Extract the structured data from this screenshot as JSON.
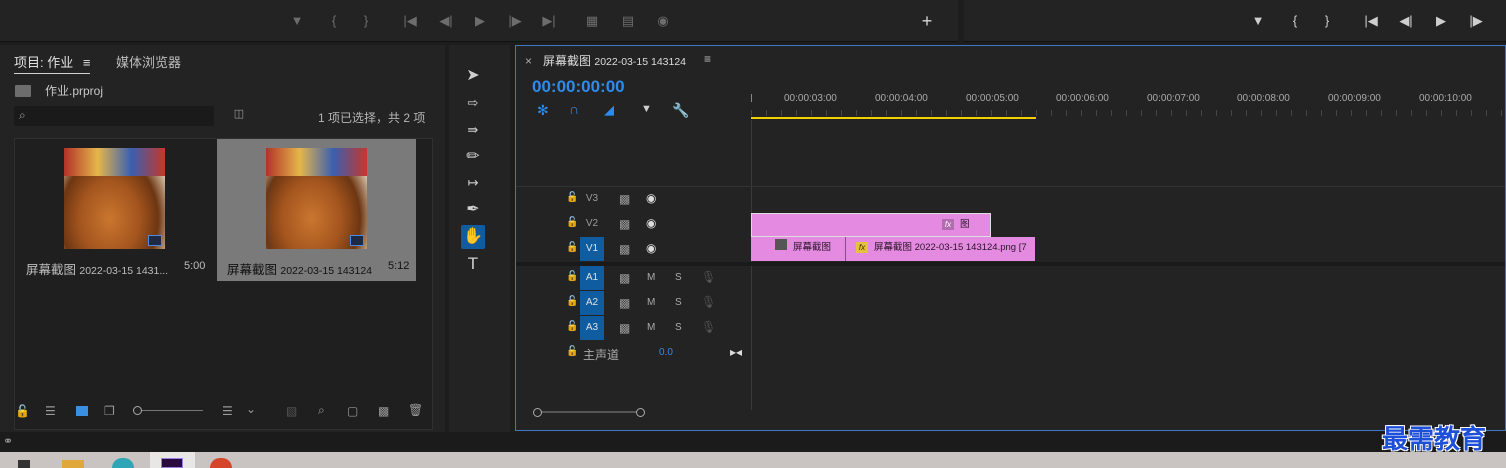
{
  "project": {
    "tabs": [
      "项目: 作业",
      "媒体浏览器"
    ],
    "menu_glyph": "≡",
    "file_name": "作业.prproj",
    "search_value": "",
    "selection_status": "1 项已选择，共 2 项",
    "items": [
      {
        "name": "屏幕截图",
        "date": "2022-03-15 1431...",
        "duration": "5:00",
        "selected": false
      },
      {
        "name": "屏幕截图",
        "date": "2022-03-15 143124",
        "duration": "5:12",
        "selected": true
      }
    ]
  },
  "timeline": {
    "sequence_title": "屏幕截图",
    "sequence_date": "2022-03-15 143124",
    "menu_glyph": "≡",
    "close_glyph": "×",
    "timecode": "00:00:00:00",
    "ruler": [
      "00:00:03:00",
      "00:00:04:00",
      "00:00:05:00",
      "00:00:06:00",
      "00:00:07:00",
      "00:00:08:00",
      "00:00:09:00",
      "00:00:10:00"
    ],
    "tracks": [
      {
        "name": "V3",
        "kind": "video",
        "targeted": false
      },
      {
        "name": "V2",
        "kind": "video",
        "targeted": false
      },
      {
        "name": "V1",
        "kind": "video",
        "targeted": true
      },
      {
        "name": "A1",
        "kind": "audio",
        "targeted": true
      },
      {
        "name": "A2",
        "kind": "audio",
        "targeted": true
      },
      {
        "name": "A3",
        "kind": "audio",
        "targeted": true
      }
    ],
    "master": {
      "label": "主声道",
      "value": "0.0"
    },
    "mute": "M",
    "solo": "S",
    "fx": "fx",
    "clip_v2": "图",
    "clip_v1a": "屏幕截图",
    "clip_v1b": "屏幕截图 2022-03-15  143124.png [7"
  },
  "colors": {
    "accent": "#2d8ceb",
    "clip": "#e48ae0",
    "selected": "#7a7a7a",
    "panel": "#232323"
  },
  "watermark": "最需教育"
}
